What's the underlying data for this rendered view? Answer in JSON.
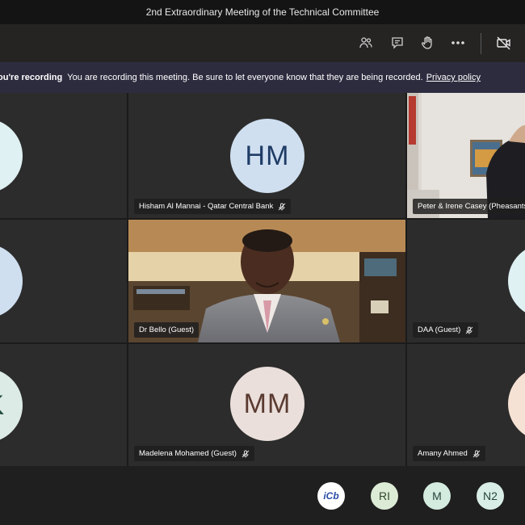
{
  "window": {
    "title": "2nd Extraordinary Meeting of the Technical Committee"
  },
  "toolbar": {
    "icons": [
      "participants-icon",
      "chat-icon",
      "raise-hand-icon",
      "more-options-icon",
      "camera-off-icon"
    ]
  },
  "recording_banner": {
    "title": "ou're recording",
    "message": "You are recording this meeting. Be sure to let everyone know that they are being recorded.",
    "link": "Privacy policy"
  },
  "participants": [
    {
      "initials": "",
      "name": "",
      "avatar_color": "#dff1f3",
      "text_color": "#134b52"
    },
    {
      "initials": "HM",
      "name": "Hisham Al Mannai - Qatar Central Bank",
      "avatar_color": "#cfdff0",
      "text_color": "#1f3c66",
      "muted": true
    },
    {
      "initials": "",
      "name": "Peter & Irene Casey (Pheasants)",
      "video": true
    },
    {
      "initials": "",
      "name": "",
      "avatar_color": "#cfdff0",
      "text_color": "#1f3c66"
    },
    {
      "initials": "",
      "name": "Dr Bello (Guest)",
      "video": true
    },
    {
      "initials": "",
      "name": "DAA (Guest)",
      "avatar_color": "#dff1f3",
      "text_color": "#134b52",
      "muted": true
    },
    {
      "initials": "K",
      "name": "",
      "avatar_color": "#dcebe5",
      "text_color": "#1f4a3a"
    },
    {
      "initials": "MM",
      "name": "Madelena Mohamed (Guest)",
      "avatar_color": "#eadfdb",
      "text_color": "#5a3a30",
      "muted": true
    },
    {
      "initials": "",
      "name": "Amany Ahmed",
      "avatar_color": "#f6e2d4",
      "text_color": "#7a4a2a",
      "muted": true
    }
  ],
  "bottom_bubbles": [
    {
      "label": "iCb",
      "color": "#ffffff",
      "text_color": "#2a4ea8"
    },
    {
      "label": "RI",
      "color": "#dcebd6",
      "text_color": "#2f4a2a"
    },
    {
      "label": "M",
      "color": "#d4ebe0",
      "text_color": "#25453a"
    },
    {
      "label": "N2",
      "color": "#d8ede6",
      "text_color": "#25453a"
    }
  ]
}
